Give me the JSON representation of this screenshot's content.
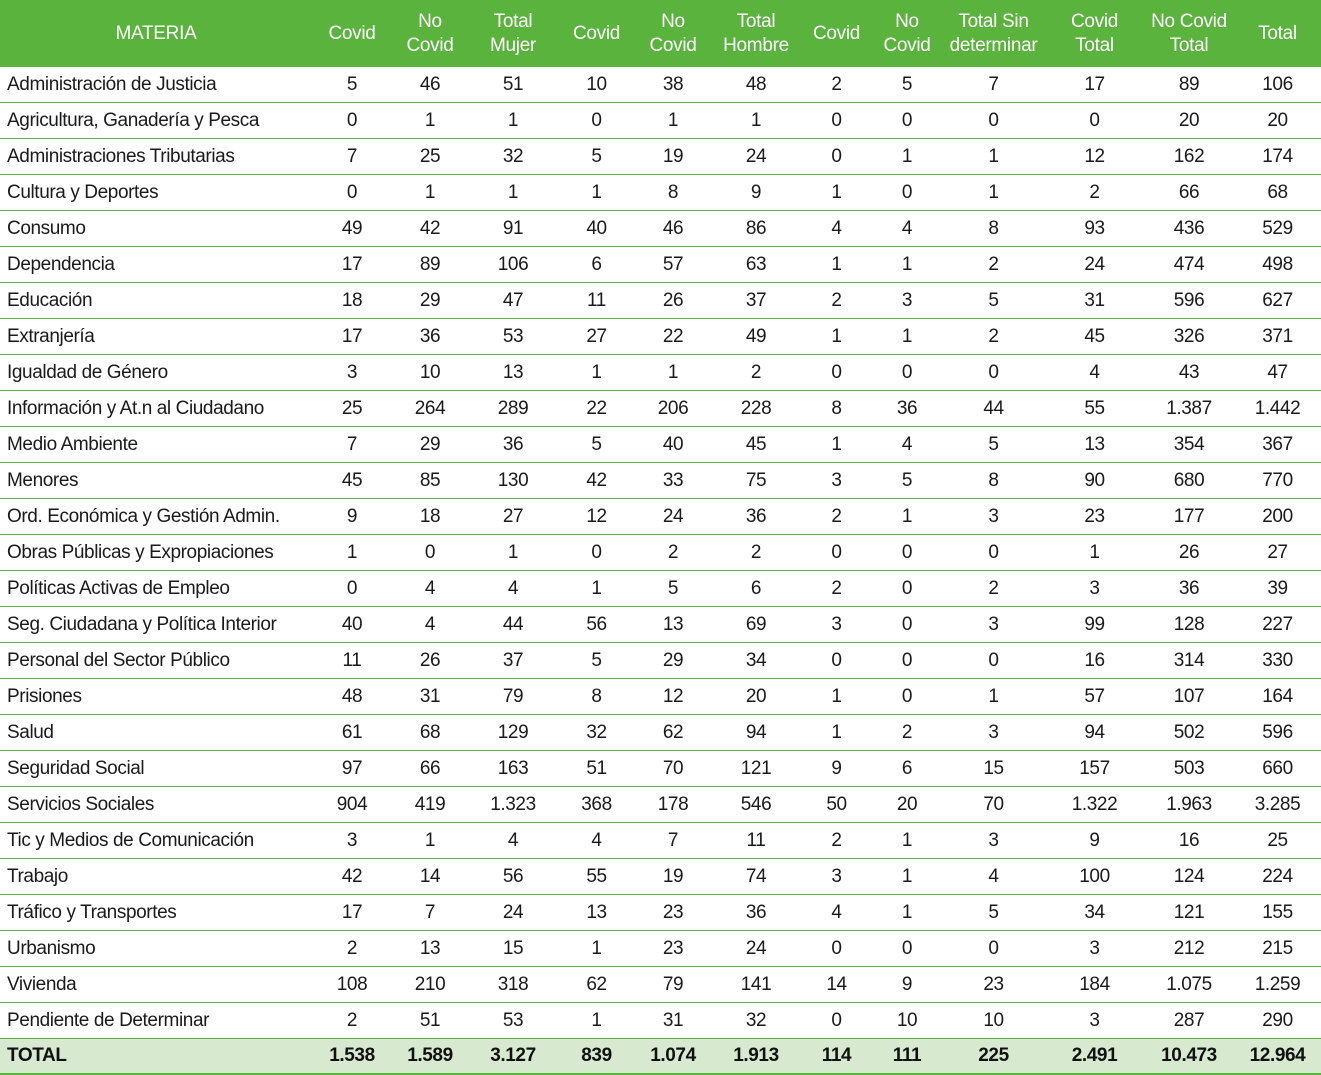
{
  "headers": [
    [
      "MATERIA"
    ],
    [
      "Covid"
    ],
    [
      "No",
      "Covid"
    ],
    [
      "Total",
      "Mujer"
    ],
    [
      "Covid"
    ],
    [
      "No",
      "Covid"
    ],
    [
      "Total",
      "Hombre"
    ],
    [
      "Covid"
    ],
    [
      "No",
      "Covid"
    ],
    [
      "Total Sin",
      "determinar"
    ],
    [
      "Covid",
      "Total"
    ],
    [
      "No Covid",
      "Total"
    ],
    [
      "Total"
    ]
  ],
  "rows": [
    [
      "Administración de Justicia",
      "5",
      "46",
      "51",
      "10",
      "38",
      "48",
      "2",
      "5",
      "7",
      "17",
      "89",
      "106"
    ],
    [
      "Agricultura, Ganadería y Pesca",
      "0",
      "1",
      "1",
      "0",
      "1",
      "1",
      "0",
      "0",
      "0",
      "0",
      "20",
      "20"
    ],
    [
      "Administraciones Tributarias",
      "7",
      "25",
      "32",
      "5",
      "19",
      "24",
      "0",
      "1",
      "1",
      "12",
      "162",
      "174"
    ],
    [
      "Cultura y Deportes",
      "0",
      "1",
      "1",
      "1",
      "8",
      "9",
      "1",
      "0",
      "1",
      "2",
      "66",
      "68"
    ],
    [
      "Consumo",
      "49",
      "42",
      "91",
      "40",
      "46",
      "86",
      "4",
      "4",
      "8",
      "93",
      "436",
      "529"
    ],
    [
      "Dependencia",
      "17",
      "89",
      "106",
      "6",
      "57",
      "63",
      "1",
      "1",
      "2",
      "24",
      "474",
      "498"
    ],
    [
      "Educación",
      "18",
      "29",
      "47",
      "11",
      "26",
      "37",
      "2",
      "3",
      "5",
      "31",
      "596",
      "627"
    ],
    [
      "Extranjería",
      "17",
      "36",
      "53",
      "27",
      "22",
      "49",
      "1",
      "1",
      "2",
      "45",
      "326",
      "371"
    ],
    [
      "Igualdad de Género",
      "3",
      "10",
      "13",
      "1",
      "1",
      "2",
      "0",
      "0",
      "0",
      "4",
      "43",
      "47"
    ],
    [
      "Información y At.n al Ciudadano",
      "25",
      "264",
      "289",
      "22",
      "206",
      "228",
      "8",
      "36",
      "44",
      "55",
      "1.387",
      "1.442"
    ],
    [
      "Medio Ambiente",
      "7",
      "29",
      "36",
      "5",
      "40",
      "45",
      "1",
      "4",
      "5",
      "13",
      "354",
      "367"
    ],
    [
      "Menores",
      "45",
      "85",
      "130",
      "42",
      "33",
      "75",
      "3",
      "5",
      "8",
      "90",
      "680",
      "770"
    ],
    [
      "Ord. Económica y Gestión Admin.",
      "9",
      "18",
      "27",
      "12",
      "24",
      "36",
      "2",
      "1",
      "3",
      "23",
      "177",
      "200"
    ],
    [
      "Obras Públicas y Expropiaciones",
      "1",
      "0",
      "1",
      "0",
      "2",
      "2",
      "0",
      "0",
      "0",
      "1",
      "26",
      "27"
    ],
    [
      "Políticas Activas de Empleo",
      "0",
      "4",
      "4",
      "1",
      "5",
      "6",
      "2",
      "0",
      "2",
      "3",
      "36",
      "39"
    ],
    [
      "Seg. Ciudadana y Política Interior",
      "40",
      "4",
      "44",
      "56",
      "13",
      "69",
      "3",
      "0",
      "3",
      "99",
      "128",
      "227"
    ],
    [
      "Personal del Sector Público",
      "11",
      "26",
      "37",
      "5",
      "29",
      "34",
      "0",
      "0",
      "0",
      "16",
      "314",
      "330"
    ],
    [
      "Prisiones",
      "48",
      "31",
      "79",
      "8",
      "12",
      "20",
      "1",
      "0",
      "1",
      "57",
      "107",
      "164"
    ],
    [
      "Salud",
      "61",
      "68",
      "129",
      "32",
      "62",
      "94",
      "1",
      "2",
      "3",
      "94",
      "502",
      "596"
    ],
    [
      "Seguridad Social",
      "97",
      "66",
      "163",
      "51",
      "70",
      "121",
      "9",
      "6",
      "15",
      "157",
      "503",
      "660"
    ],
    [
      "Servicios Sociales",
      "904",
      "419",
      "1.323",
      "368",
      "178",
      "546",
      "50",
      "20",
      "70",
      "1.322",
      "1.963",
      "3.285"
    ],
    [
      "Tic y Medios de Comunicación",
      "3",
      "1",
      "4",
      "4",
      "7",
      "11",
      "2",
      "1",
      "3",
      "9",
      "16",
      "25"
    ],
    [
      "Trabajo",
      "42",
      "14",
      "56",
      "55",
      "19",
      "74",
      "3",
      "1",
      "4",
      "100",
      "124",
      "224"
    ],
    [
      "Tráfico y Transportes",
      "17",
      "7",
      "24",
      "13",
      "23",
      "36",
      "4",
      "1",
      "5",
      "34",
      "121",
      "155"
    ],
    [
      "Urbanismo",
      "2",
      "13",
      "15",
      "1",
      "23",
      "24",
      "0",
      "0",
      "0",
      "3",
      "212",
      "215"
    ],
    [
      "Vivienda",
      "108",
      "210",
      "318",
      "62",
      "79",
      "141",
      "14",
      "9",
      "23",
      "184",
      "1.075",
      "1.259"
    ],
    [
      "Pendiente de Determinar",
      "2",
      "51",
      "53",
      "1",
      "31",
      "32",
      "0",
      "10",
      "10",
      "3",
      "287",
      "290"
    ]
  ],
  "total": [
    "TOTAL",
    "1.538",
    "1.589",
    "3.127",
    "839",
    "1.074",
    "1.913",
    "114",
    "111",
    "225",
    "2.491",
    "10.473",
    "12.964"
  ],
  "colors": {
    "header_bg": "#5ab33d",
    "total_bg": "#d7ead0",
    "rule": "#5ab33d"
  }
}
